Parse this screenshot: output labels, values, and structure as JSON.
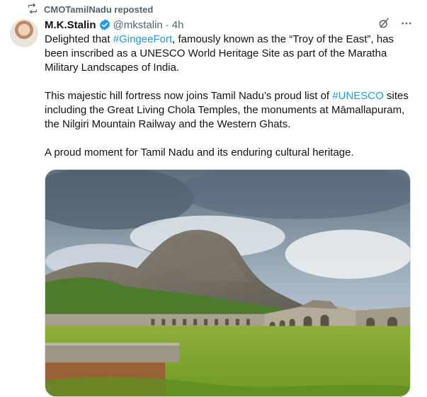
{
  "repost": {
    "icon": "repost-icon",
    "label": "CMOTamilNadu reposted"
  },
  "author": {
    "name": "M.K.Stalin",
    "handle": "@mkstalin",
    "separator": "·",
    "time": "4h",
    "verified_color": "#1d9bf0"
  },
  "tweet": {
    "paragraph1": {
      "before": "Delighted that ",
      "hashtag": "#GingeeFort",
      "after": ", famously known as the “Troy of the East”, has been inscribed as a UNESCO World Heritage Site as part of the Maratha Military Landscapes of India."
    },
    "paragraph2": {
      "before": "This majestic hill fortress now joins Tamil Nadu’s proud list of ",
      "hashtag": "#UNESCO",
      "after": " sites including the Great Living Chola Temples, the monuments at Māmallapuram, the Nilgiri Mountain Railway and the Western Ghats."
    },
    "paragraph3": "A proud moment for Tamil Nadu and its enduring cultural heritage."
  },
  "icons": {
    "grok": "grok-icon",
    "more": "more-icon"
  },
  "colors": {
    "text": "#0f1419",
    "secondary": "#536471",
    "link": "#1d9bf0"
  }
}
